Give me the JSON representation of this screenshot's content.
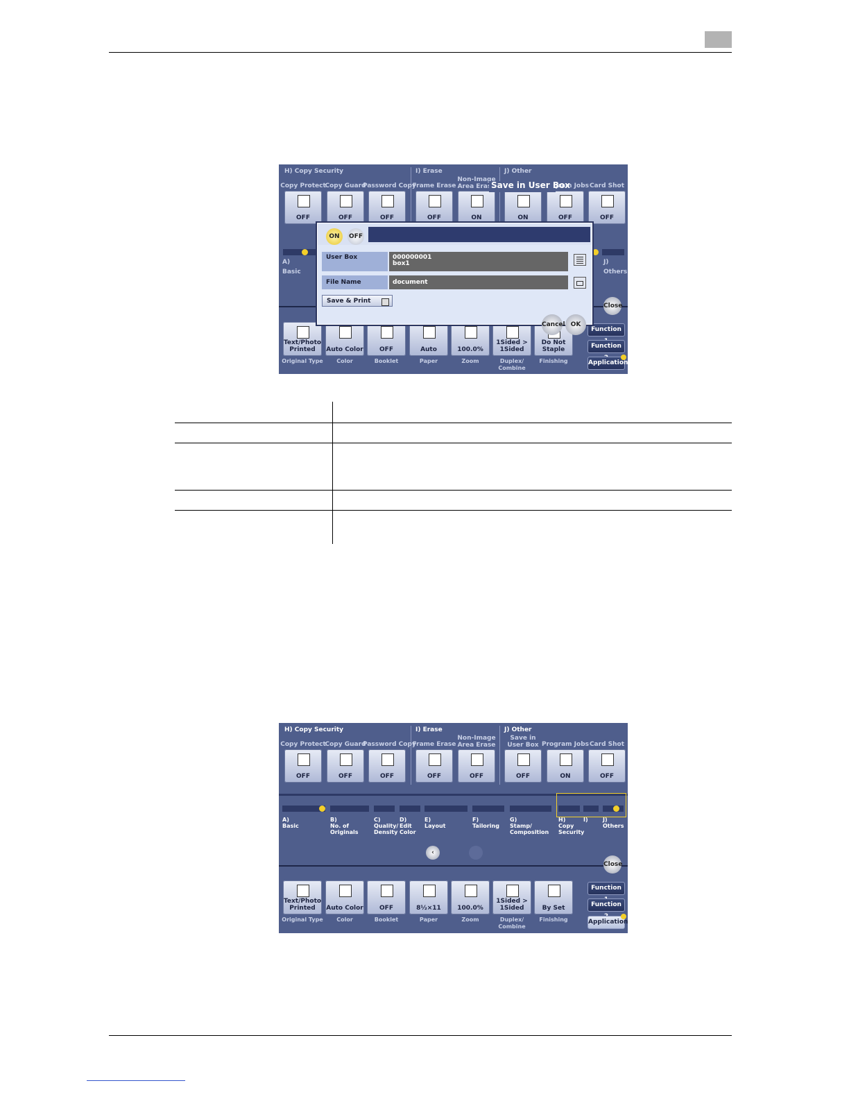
{
  "screen1": {
    "groups": {
      "copy_security": "H)   Copy Security",
      "erase": "I)    Erase",
      "other": "J)    Other"
    },
    "buttons": [
      {
        "label": "Copy Protect",
        "value": "OFF",
        "icon": "copy-protect-icon"
      },
      {
        "label": "Copy Guard",
        "value": "OFF",
        "icon": "copy-guard-icon"
      },
      {
        "label": "Password Copy",
        "value": "OFF",
        "icon": "password-copy-icon"
      },
      {
        "label": "Frame Erase",
        "value": "OFF",
        "icon": "frame-erase-icon"
      },
      {
        "label": "Non-Image\nArea Erase",
        "value": "ON",
        "icon": "non-image-erase-icon"
      },
      {
        "label": "Save in User Box",
        "value": "ON",
        "icon": "user-box-icon"
      },
      {
        "label": "Program Jobs",
        "value": "OFF",
        "icon": "program-jobs-icon"
      },
      {
        "label": "Card Shot",
        "value": "OFF",
        "icon": "card-shot-icon"
      }
    ],
    "side_labels": {
      "left_letter": "A)",
      "left_name": "Basic",
      "right_letter": "J)",
      "right_name": "Others"
    },
    "dialog": {
      "on": "ON",
      "off": "OFF",
      "user_box_label": "User Box",
      "user_box_number": "000000001",
      "user_box_name": "box1",
      "file_name_label": "File Name",
      "file_name_value": "document",
      "save_print": "Save & Print",
      "cancel": "Cancel",
      "ok": "OK"
    },
    "close": "Close",
    "function1": "Function 1",
    "function2": "Function 2",
    "application": "Application",
    "bottom": [
      {
        "value": "Text/Photo\nPrinted",
        "caption": "Original Type"
      },
      {
        "value": "Auto Color",
        "caption": "Color"
      },
      {
        "value": "OFF",
        "caption": "Booklet"
      },
      {
        "value": "Auto",
        "caption": "Paper"
      },
      {
        "value": "100.0%",
        "caption": "Zoom"
      },
      {
        "value": "1Sided >\n1Sided",
        "caption": "Duplex/\nCombine"
      },
      {
        "value": "Do Not\nStaple",
        "caption": "Finishing"
      }
    ]
  },
  "screen2": {
    "groups": {
      "copy_security": "H)   Copy Security",
      "erase": "I)    Erase",
      "other": "J)    Other"
    },
    "buttons": [
      {
        "label": "Copy Protect",
        "value": "OFF",
        "icon": "copy-protect-icon"
      },
      {
        "label": "Copy Guard",
        "value": "OFF",
        "icon": "copy-guard-icon"
      },
      {
        "label": "Password Copy",
        "value": "OFF",
        "icon": "password-copy-icon"
      },
      {
        "label": "Frame Erase",
        "value": "OFF",
        "icon": "frame-erase-icon"
      },
      {
        "label": "Non-Image\nArea Erase",
        "value": "OFF",
        "icon": "non-image-erase-icon"
      },
      {
        "label": "Save in\nUser Box",
        "value": "OFF",
        "icon": "user-box-icon"
      },
      {
        "label": "Program Jobs",
        "value": "ON",
        "icon": "program-jobs-icon"
      },
      {
        "label": "Card Shot",
        "value": "OFF",
        "icon": "card-shot-icon"
      }
    ],
    "tabs": [
      {
        "letter": "A)",
        "name": "Basic"
      },
      {
        "letter": "B)",
        "name": "No. of\nOriginals"
      },
      {
        "letter": "C)",
        "name": "Quality/\nDensity"
      },
      {
        "letter": "D)",
        "name": "Edit\nColor"
      },
      {
        "letter": "E)",
        "name": "Layout"
      },
      {
        "letter": "F)",
        "name": "Tailoring"
      },
      {
        "letter": "G)",
        "name": "Stamp/\nComposition"
      },
      {
        "letter": "H)",
        "name": "Copy\nSecurity"
      },
      {
        "letter": "I)",
        "name": ""
      },
      {
        "letter": "J)",
        "name": "Others"
      }
    ],
    "close": "Close",
    "function1": "Function 1",
    "function2": "Function 2",
    "application": "Application",
    "bottom": [
      {
        "value": "Text/Photo\nPrinted",
        "caption": "Original Type"
      },
      {
        "value": "Auto Color",
        "caption": "Color"
      },
      {
        "value": "OFF",
        "caption": "Booklet"
      },
      {
        "value": "8½×11",
        "caption": "Paper"
      },
      {
        "value": "100.0%",
        "caption": "Zoom"
      },
      {
        "value": "1Sided >\n1Sided",
        "caption": "Duplex/\nCombine"
      },
      {
        "value": "By Set",
        "caption": "Finishing"
      }
    ]
  },
  "colors": {
    "panel": "#4f5e8c",
    "accent": "#f3cf2a",
    "dialog": "#dfe7f7"
  }
}
